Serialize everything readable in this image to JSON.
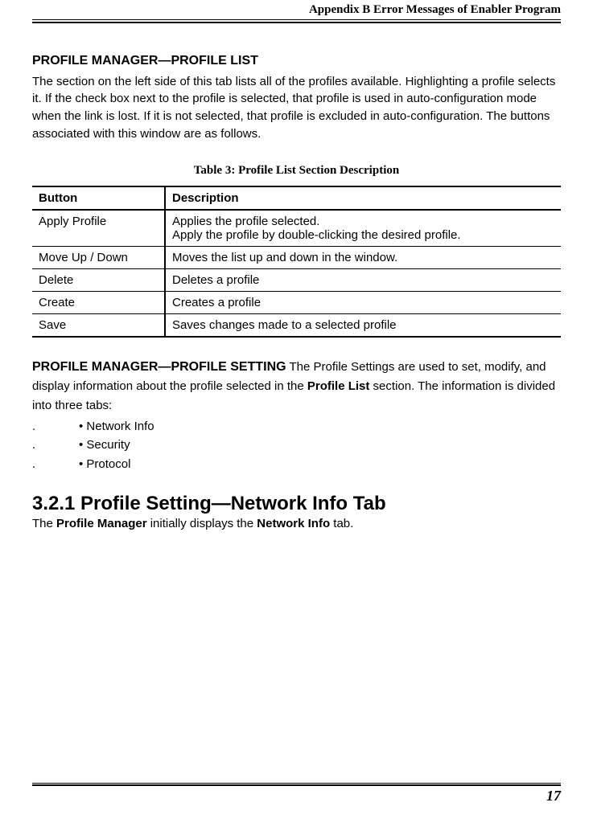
{
  "header": {
    "running_title": "Appendix B Error Messages of Enabler Program"
  },
  "section1": {
    "heading": "PROFILE MANAGER—PROFILE LIST",
    "body": "The section on the left side of this tab lists all of the profiles available. Highlighting a profile selects it. If the check box next to the profile is selected, that profile is used in auto-configuration mode when the link is lost. If it is not selected, that profile is excluded in auto-configuration. The buttons associated with this window are as follows."
  },
  "table": {
    "caption": "Table 3: Profile List Section Description",
    "head": {
      "c1": "Button",
      "c2": "Description"
    },
    "rows": [
      {
        "c1": "Apply Profile",
        "c2a": "Applies the profile selected.",
        "c2b": "Apply the profile by double-clicking the desired profile."
      },
      {
        "c1": "Move Up / Down",
        "c2a": "Moves the list up and down in the window."
      },
      {
        "c1": "Delete",
        "c2a": "Deletes a profile"
      },
      {
        "c1": "Create",
        "c2a": "Creates a profile"
      },
      {
        "c1": "Save",
        "c2a": "Saves changes made to a selected profile"
      }
    ]
  },
  "section2": {
    "inline_head": "PROFILE MANAGER—PROFILE SETTING",
    "body_before_bold1": " The Profile Settings are used to set, modify, and display information about the profile selected in the ",
    "bold1": "Profile List",
    "body_after_bold1": " section. The information is divided into three tabs:",
    "bullets": [
      "• Network Info",
      "• Security",
      "• Protocol"
    ]
  },
  "h2": "3.2.1 Profile Setting—Network Info Tab",
  "para3": {
    "t1": "The ",
    "b1": "Profile Manager",
    "t2": " initially displays the ",
    "b2": "Network Info",
    "t3": " tab."
  },
  "footer": {
    "page": "17"
  }
}
